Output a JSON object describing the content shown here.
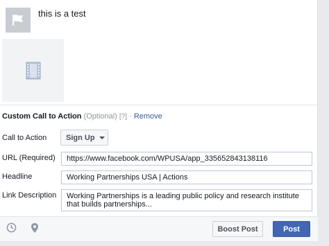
{
  "post": {
    "status_text": "this is a test",
    "avatar_icon": "flag-icon",
    "thumbnail_icon": "film-icon"
  },
  "cta": {
    "title": "Custom Call to Action",
    "optional": "(Optional)",
    "help": "[?]",
    "separator": "·",
    "remove": "Remove",
    "call_to_action_label": "Call to Action",
    "call_to_action_value": "Sign Up",
    "url_label": "URL (Required)",
    "url_value": "https://www.facebook.com/WPUSA/app_335652843138116",
    "headline_label": "Headline",
    "headline_value": "Working Partnerships USA | Actions",
    "link_desc_label": "Link Description",
    "link_desc_value": "Working Partnerships is a leading public policy and research institute that builds partnerships..."
  },
  "footer": {
    "schedule_icon": "clock-icon",
    "location_icon": "location-pin-icon",
    "boost_label": "Boost Post",
    "post_label": "Post"
  },
  "colors": {
    "brand_blue": "#4267b2",
    "link_blue": "#3b5998"
  }
}
